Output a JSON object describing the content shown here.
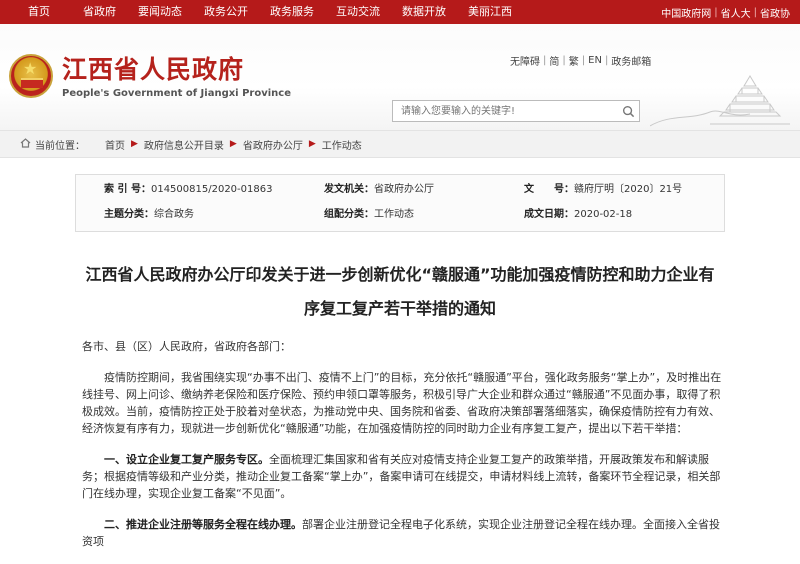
{
  "topnav": {
    "items": [
      "首页",
      "省政府",
      "要闻动态",
      "政务公开",
      "政务服务",
      "互动交流",
      "数据开放",
      "美丽江西"
    ],
    "right_links": [
      "中国政府网",
      "省人大",
      "省政协"
    ]
  },
  "header": {
    "title_cn": "江西省人民政府",
    "title_en": "People's Government of Jiangxi Province",
    "tools": [
      "无障碍",
      "简",
      "繁",
      "EN",
      "政务邮箱"
    ],
    "search_placeholder": "请输入您要输入的关键字!"
  },
  "breadcrumb": {
    "label": "当前位置：",
    "items": [
      "首页",
      "政府信息公开目录",
      "省政府办公厅",
      "工作动态"
    ]
  },
  "meta": {
    "index_label": "索 引 号：",
    "index_value": "014500815/2020-01863",
    "issuer_label": "发文机关：",
    "issuer_value": "省政府办公厅",
    "docno_label": "文　　号：",
    "docno_value": "赣府厅明〔2020〕21号",
    "subject_label": "主题分类：",
    "subject_value": "综合政务",
    "author_label": "组配分类：",
    "author_value": "工作动态",
    "date_label": "成文日期：",
    "date_value": "2020-02-18"
  },
  "article": {
    "title_line1": "江西省人民政府办公厅印发关于进一步创新优化“赣服通”功能加强疫情防控和助力企业有",
    "title_line2": "序复工复产若干举措的通知",
    "greeting": "各市、县（区）人民政府，省政府各部门：",
    "para1": "疫情防控期间，我省围绕实现“办事不出门、疫情不上门”的目标，充分依托“赣服通”平台，强化政务服务“掌上办”，及时推出在线挂号、网上问诊、缴纳养老保险和医疗保险、预约申领口罩等服务，积极引导广大企业和群众通过“赣服通”不见面办事，取得了积极成效。当前，疫情防控正处于胶着对垒状态，为推动党中央、国务院和省委、省政府决策部署落细落实，确保疫情防控有力有效、经济恢复有序有力，现就进一步创新优化“赣服通”功能，在加强疫情防控的同时助力企业有序复工复产，提出以下若干举措：",
    "item1_head": "一、设立企业复工复产服务专区。",
    "item1_body": "全面梳理汇集国家和省有关应对疫情支持企业复工复产的政策举措，开展政策发布和解读服务；根据疫情等级和产业分类，推动企业复工备案“掌上办”，备案申请可在线提交，申请材料线上流转，备案环节全程记录，相关部门在线办理，实现企业复工备案“不见面”。",
    "item2_head": "二、推进企业注册等服务全程在线办理。",
    "item2_body": "部署企业注册登记全程电子化系统，实现企业注册登记全程在线办理。全面接入全省投资项"
  }
}
